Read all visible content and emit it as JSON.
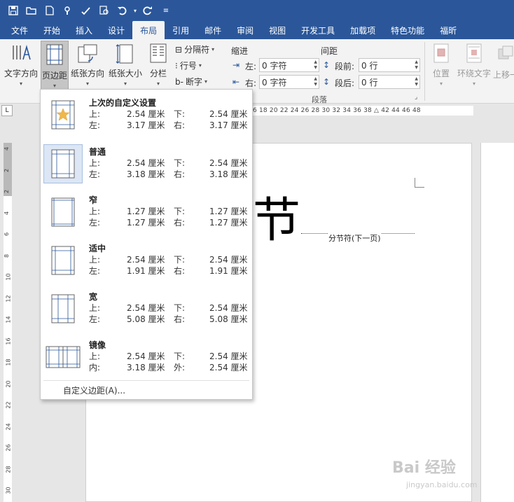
{
  "qat": {
    "icons": [
      "save-icon",
      "open-icon",
      "new-icon",
      "touch-mode-icon",
      "spelling-icon",
      "print-preview-icon",
      "undo-icon",
      "redo-icon",
      "customize-icon"
    ]
  },
  "tabs": [
    "文件",
    "开始",
    "插入",
    "设计",
    "布局",
    "引用",
    "邮件",
    "审阅",
    "视图",
    "开发工具",
    "加载项",
    "特色功能",
    "福昕"
  ],
  "active_tab": "布局",
  "ribbon": {
    "text_direction": "文字方向",
    "margins": "页边距",
    "orientation": "纸张方向",
    "size": "纸张大小",
    "columns": "分栏",
    "breaks": "分隔符",
    "line_numbers": "行号",
    "hyphenation": "断字",
    "indent_label": "缩进",
    "spacing_label": "间距",
    "indent_left_label": "左:",
    "indent_left_value": "0 字符",
    "indent_right_label": "右:",
    "indent_right_value": "0 字符",
    "before_label": "段前:",
    "before_value": "0 行",
    "after_label": "段后:",
    "after_value": "0 行",
    "paragraph_group": "段落",
    "position": "位置",
    "wrap_text": "环绕文字",
    "bring_forward": "上移一"
  },
  "ruler": {
    "corner": "L",
    "h_numbers": "6  18  20  22  24  26  28  30  32  34  36  38  △  42  44  46  48",
    "v_numbers": [
      "4",
      "2",
      "2",
      "4",
      "6",
      "8",
      "10",
      "12",
      "14",
      "16",
      "18",
      "20",
      "22",
      "24",
      "26",
      "28",
      "30"
    ]
  },
  "document": {
    "big_char": "节",
    "section_break": "分节符(下一页)"
  },
  "margins_menu": {
    "items": [
      {
        "title": "上次的自定义设置",
        "k1": "上:",
        "v1": "2.54 厘米",
        "k2": "下:",
        "v2": "2.54 厘米",
        "k3": "左:",
        "v3": "3.17 厘米",
        "k4": "右:",
        "v4": "3.17 厘米"
      },
      {
        "title": "普通",
        "k1": "上:",
        "v1": "2.54 厘米",
        "k2": "下:",
        "v2": "2.54 厘米",
        "k3": "左:",
        "v3": "3.18 厘米",
        "k4": "右:",
        "v4": "3.18 厘米"
      },
      {
        "title": "窄",
        "k1": "上:",
        "v1": "1.27 厘米",
        "k2": "下:",
        "v2": "1.27 厘米",
        "k3": "左:",
        "v3": "1.27 厘米",
        "k4": "右:",
        "v4": "1.27 厘米"
      },
      {
        "title": "适中",
        "k1": "上:",
        "v1": "2.54 厘米",
        "k2": "下:",
        "v2": "2.54 厘米",
        "k3": "左:",
        "v3": "1.91 厘米",
        "k4": "右:",
        "v4": "1.91 厘米"
      },
      {
        "title": "宽",
        "k1": "上:",
        "v1": "2.54 厘米",
        "k2": "下:",
        "v2": "2.54 厘米",
        "k3": "左:",
        "v3": "5.08 厘米",
        "k4": "右:",
        "v4": "5.08 厘米"
      },
      {
        "title": "镜像",
        "k1": "上:",
        "v1": "2.54 厘米",
        "k2": "下:",
        "v2": "2.54 厘米",
        "k3": "内:",
        "v3": "3.18 厘米",
        "k4": "外:",
        "v4": "2.54 厘米"
      }
    ],
    "custom": "自定义边距(A)..."
  },
  "watermark": {
    "brand": "Bai  经验",
    "url": "jingyan.baidu.com"
  },
  "colors": {
    "brand_blue": "#2b579a",
    "ribbon_bg": "#f3f3f3",
    "selected_item": "#dce6f4"
  }
}
